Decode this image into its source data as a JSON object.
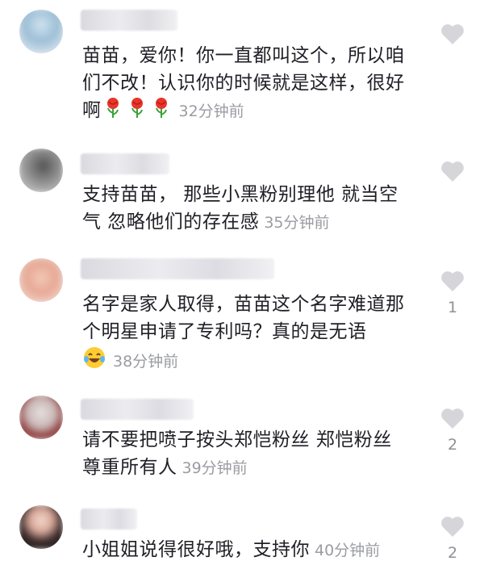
{
  "comments": [
    {
      "text": "苗苗，爱你！你一直都叫这个，所以咱们不改！认识你的时候就是这样，很好啊",
      "emoji": [
        "rose-icon",
        "rose-icon",
        "rose-icon"
      ],
      "time": "32分钟前",
      "likes": ""
    },
    {
      "text": "支持苗苗， 那些小黑粉别理他 就当空气 忽略他们的存在感",
      "emoji": [],
      "time": "35分钟前",
      "likes": ""
    },
    {
      "text": "名字是家人取得，苗苗这个名字难道那个明星申请了专利吗？真的是无语",
      "emoji": [
        "laughing-tears-icon"
      ],
      "time": "38分钟前",
      "likes": "1"
    },
    {
      "text": "请不要把喷子按头郑恺粉丝 郑恺粉丝尊重所有人",
      "emoji": [],
      "time": "39分钟前",
      "likes": "2"
    },
    {
      "text": "小姐姐说得很好哦，支持你",
      "emoji": [],
      "time": "40分钟前",
      "likes": "2"
    }
  ],
  "colors": {
    "time": "#9b9ca2",
    "heart_outline": "#d6d6da"
  }
}
